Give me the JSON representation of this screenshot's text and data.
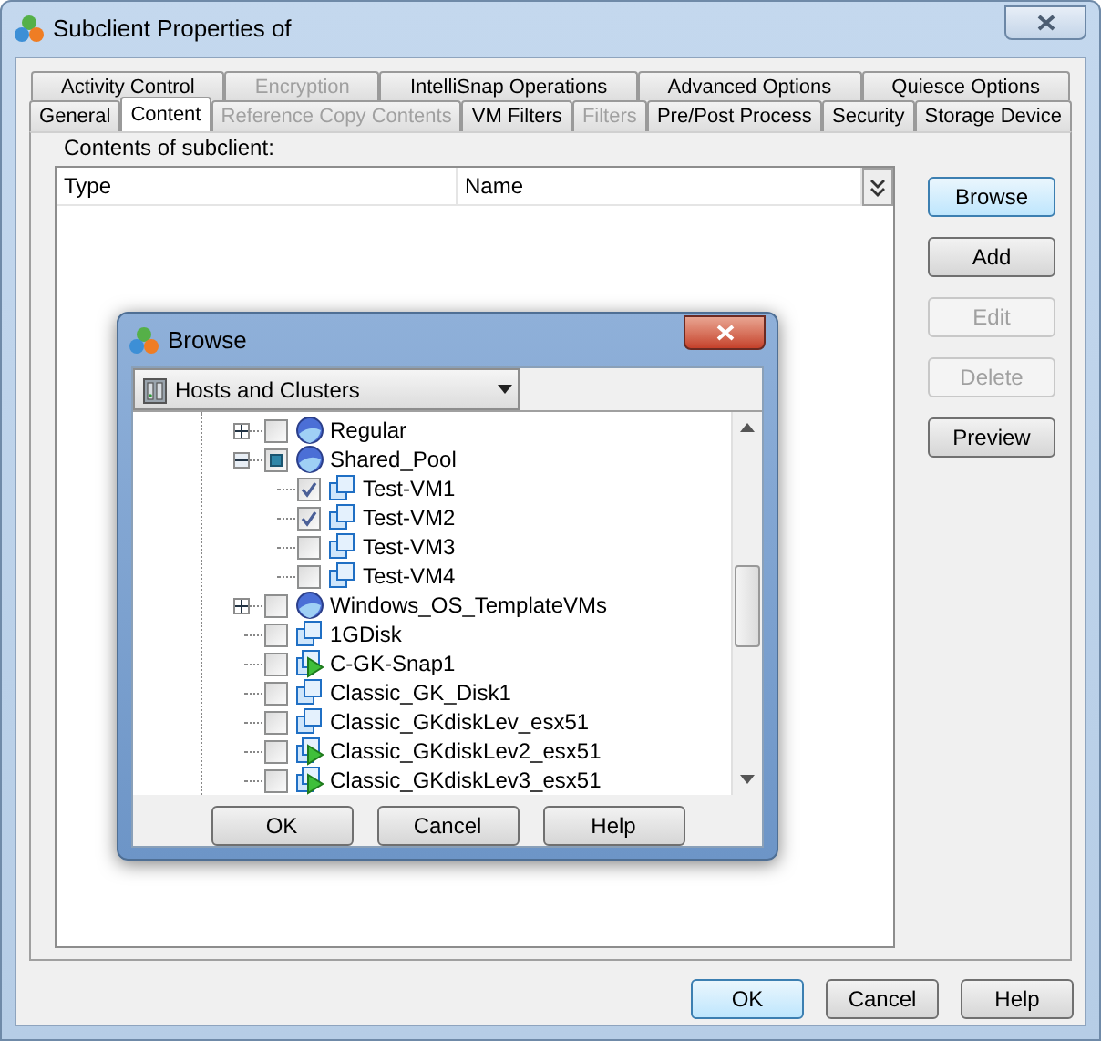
{
  "window": {
    "title": "Subclient Properties of"
  },
  "tab_rows": [
    [
      {
        "label": "Activity Control",
        "selected": false,
        "disabled": false
      },
      {
        "label": "Encryption",
        "selected": false,
        "disabled": true
      },
      {
        "label": "IntelliSnap Operations",
        "selected": false,
        "disabled": false
      },
      {
        "label": "Advanced Options",
        "selected": false,
        "disabled": false
      },
      {
        "label": "Quiesce Options",
        "selected": false,
        "disabled": false
      }
    ],
    [
      {
        "label": "General",
        "selected": false,
        "disabled": false
      },
      {
        "label": "Content",
        "selected": true,
        "disabled": false
      },
      {
        "label": "Reference Copy Contents",
        "selected": false,
        "disabled": true
      },
      {
        "label": "VM Filters",
        "selected": false,
        "disabled": false
      },
      {
        "label": "Filters",
        "selected": false,
        "disabled": true
      },
      {
        "label": "Pre/Post Process",
        "selected": false,
        "disabled": false
      },
      {
        "label": "Security",
        "selected": false,
        "disabled": false
      },
      {
        "label": "Storage Device",
        "selected": false,
        "disabled": false
      }
    ]
  ],
  "contents_label": "Contents of subclient:",
  "table": {
    "columns": [
      "Type",
      "Name"
    ]
  },
  "side_buttons": [
    {
      "label": "Browse",
      "disabled": false,
      "focused": true
    },
    {
      "label": "Add",
      "disabled": false,
      "focused": false
    },
    {
      "label": "Edit",
      "disabled": true
    },
    {
      "label": "Delete",
      "disabled": true
    },
    {
      "label": "Preview",
      "disabled": false,
      "focused": false
    }
  ],
  "browse_dialog": {
    "title": "Browse",
    "view": "Hosts and Clusters",
    "tree": [
      {
        "label": "Regular",
        "kind": "pool",
        "checked": false,
        "expanded": false
      },
      {
        "label": "Shared_Pool",
        "kind": "pool",
        "checked": false,
        "partial": true,
        "expanded": true,
        "children": [
          {
            "label": "Test-VM1",
            "kind": "vm",
            "checked": true
          },
          {
            "label": "Test-VM2",
            "kind": "vm",
            "checked": true
          },
          {
            "label": "Test-VM3",
            "kind": "vm",
            "checked": false
          },
          {
            "label": "Test-VM4",
            "kind": "vm",
            "checked": false
          }
        ]
      },
      {
        "label": "Windows_OS_TemplateVMs",
        "kind": "pool",
        "checked": false,
        "expanded": false
      },
      {
        "label": "1GDisk",
        "kind": "vm",
        "checked": false
      },
      {
        "label": "C-GK-Snap1",
        "kind": "vm-running",
        "checked": false
      },
      {
        "label": "Classic_GK_Disk1",
        "kind": "vm",
        "checked": false
      },
      {
        "label": "Classic_GKdiskLev_esx51",
        "kind": "vm",
        "checked": false
      },
      {
        "label": "Classic_GKdiskLev2_esx51",
        "kind": "vm-running",
        "checked": false
      },
      {
        "label": "Classic_GKdiskLev3_esx51",
        "kind": "vm-running",
        "checked": false
      }
    ],
    "buttons": [
      {
        "label": "OK"
      },
      {
        "label": "Cancel"
      },
      {
        "label": "Help"
      }
    ]
  },
  "footer_buttons": [
    {
      "label": "OK",
      "focused": true
    },
    {
      "label": "Cancel",
      "focused": false
    },
    {
      "label": "Help",
      "focused": false
    }
  ]
}
